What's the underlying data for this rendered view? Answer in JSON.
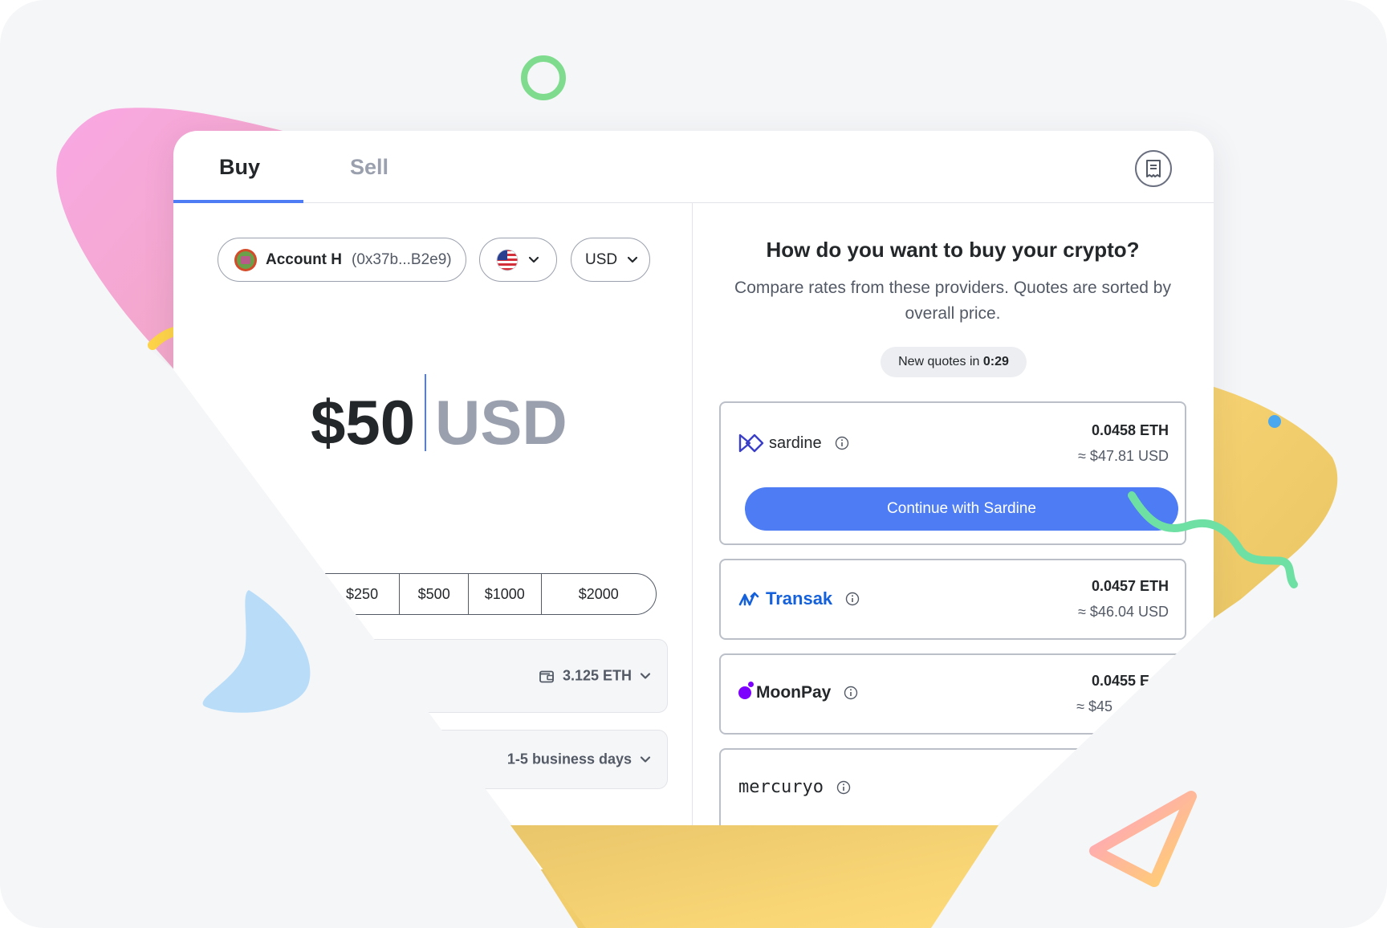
{
  "tabs": {
    "buy": "Buy",
    "sell": "Sell"
  },
  "account": {
    "name": "Account H",
    "address": "(0x37b...B2e9)"
  },
  "region": {
    "flag": "us-flag-icon"
  },
  "currency": {
    "label": "USD"
  },
  "amount": {
    "value": "$50",
    "unit": "USD"
  },
  "quick_amounts": [
    "$250",
    "$500",
    "$1000",
    "$2000"
  ],
  "payment": {
    "balance": "3.125 ETH"
  },
  "speed": {
    "label": "1-5 business days"
  },
  "providers_panel": {
    "title": "How do you want to buy your crypto?",
    "subtitle": "Compare rates from these providers. Quotes are sorted by overall price.",
    "timer_prefix": "New quotes in",
    "timer_value": "0:29"
  },
  "quotes": [
    {
      "provider": "sardine",
      "eth": "0.0458 ETH",
      "usd": "≈ $47.81 USD",
      "cta": "Continue with Sardine"
    },
    {
      "provider": "Transak",
      "eth": "0.0457 ETH",
      "usd": "≈ $46.04 USD"
    },
    {
      "provider": "MoonPay",
      "eth": "0.0455 E",
      "usd": "≈ $45"
    },
    {
      "provider": "mercuryo"
    }
  ],
  "colors": {
    "accent": "#4d7cf4",
    "text": "#24272a",
    "muted": "#9aa0ad"
  }
}
